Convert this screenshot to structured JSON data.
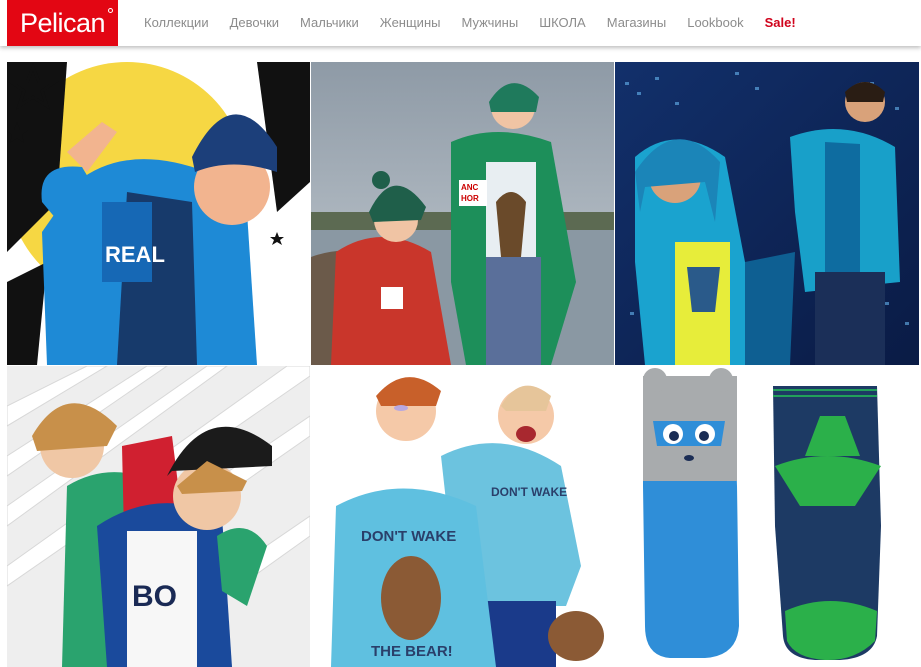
{
  "brand": {
    "name": "Pelican"
  },
  "nav": {
    "items": [
      {
        "label": "Коллекции"
      },
      {
        "label": "Девочки"
      },
      {
        "label": "Мальчики"
      },
      {
        "label": "Женщины"
      },
      {
        "label": "Мужчины"
      },
      {
        "label": "ШКОЛА"
      },
      {
        "label": "Магазины"
      },
      {
        "label": "Lookbook"
      }
    ],
    "sale_label": "Sale!",
    "text_color": "#8c8c8c",
    "sale_color": "#d0021b"
  },
  "colors": {
    "brand_red": "#e30613",
    "page_bg": "#ffffff"
  },
  "tiles": [
    {
      "photo_text": [
        "REAL"
      ]
    },
    {
      "photo_text": [
        "ANC",
        "HOR"
      ]
    },
    {
      "photo_text": []
    },
    {
      "photo_text": [
        "BO"
      ]
    },
    {
      "photo_text": [
        "DON'T WAKE",
        "THE BEAR!"
      ]
    },
    {
      "photo_text": []
    }
  ]
}
